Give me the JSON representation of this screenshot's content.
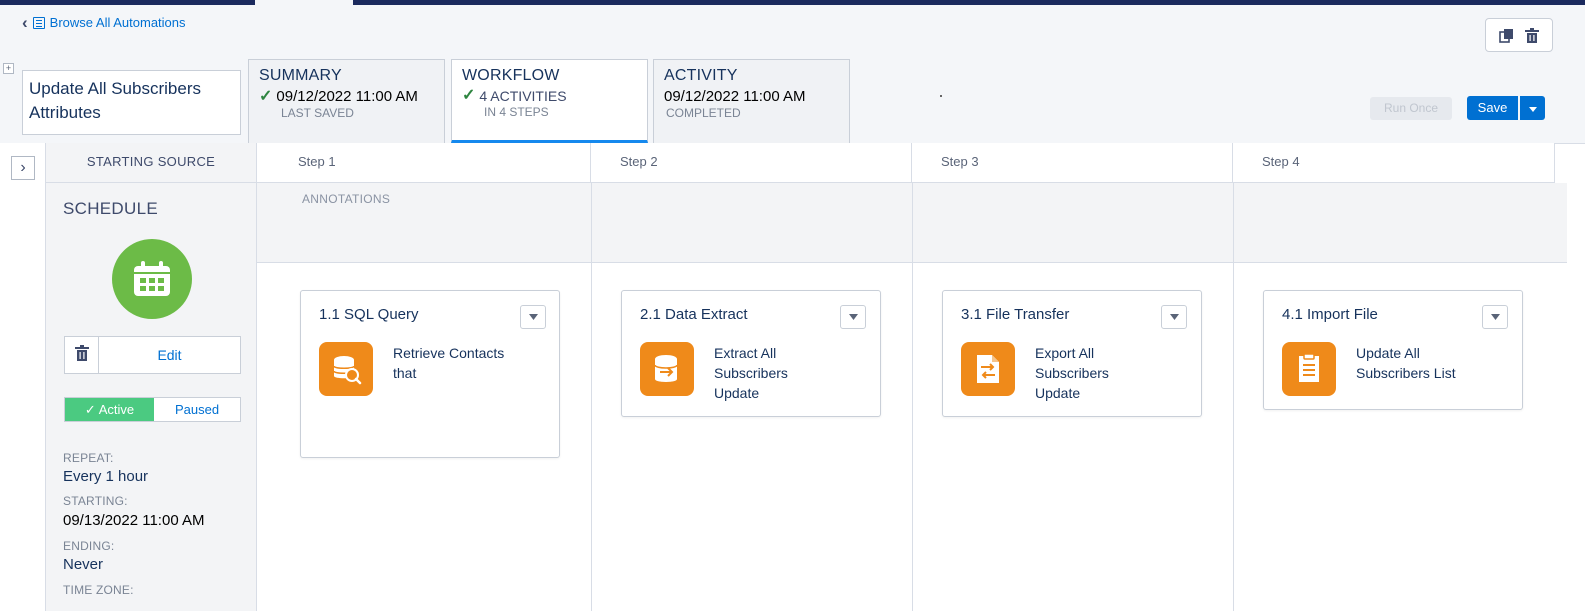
{
  "header": {
    "back_link": "Browse All Automations"
  },
  "automation": {
    "name": "Update All Subscribers Attributes"
  },
  "tabs": [
    {
      "title": "SUMMARY",
      "value": "09/12/2022 11:00 AM",
      "sub": "LAST SAVED",
      "checked": true
    },
    {
      "title": "WORKFLOW",
      "value": "4 ACTIVITIES",
      "sub": "IN 4 STEPS",
      "checked": true
    },
    {
      "title": "ACTIVITY",
      "value": "09/12/2022 11:00 AM",
      "sub": "COMPLETED",
      "checked": false
    }
  ],
  "actions": {
    "run_once": "Run Once",
    "save": "Save"
  },
  "source": {
    "header": "STARTING SOURCE",
    "title": "SCHEDULE",
    "edit": "Edit",
    "active": "Active",
    "paused": "Paused",
    "repeat_label": "REPEAT:",
    "repeat_value": "Every 1 hour",
    "starting_label": "STARTING:",
    "starting_value": "09/13/2022 11:00 AM",
    "ending_label": "ENDING:",
    "ending_value": "Never",
    "timezone_label": "TIME ZONE:"
  },
  "steps": [
    {
      "label": "Step 1"
    },
    {
      "label": "Step 2"
    },
    {
      "label": "Step 3"
    },
    {
      "label": "Step 4"
    }
  ],
  "annotations_label": "ANNOTATIONS",
  "activities": [
    {
      "title": "1.1 SQL Query",
      "description": "Retrieve Contacts that",
      "icon": "sql-query-icon"
    },
    {
      "title": "2.1 Data Extract",
      "description": "Extract All Subscribers Update",
      "icon": "data-extract-icon"
    },
    {
      "title": "3.1 File Transfer",
      "description": "Export All Subscribers Update",
      "icon": "file-transfer-icon"
    },
    {
      "title": "4.1 Import File",
      "description": "Update All Subscribers List",
      "icon": "import-file-icon"
    }
  ],
  "colors": {
    "primary": "#0070d2",
    "schedule_green": "#6cbb47",
    "activity_orange": "#ef8a1a",
    "active_green": "#4bca81"
  }
}
